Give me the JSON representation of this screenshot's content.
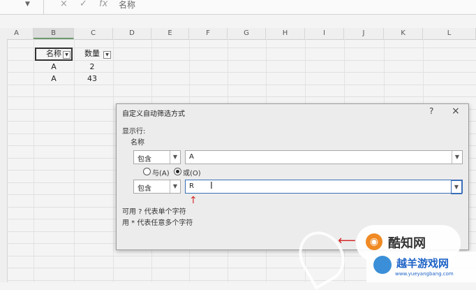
{
  "formula_bar": {
    "cancel_glyph": "×",
    "enter_glyph": "✓",
    "fx_glyph": "fx",
    "content": "名称"
  },
  "columns": [
    "A",
    "B",
    "C",
    "D",
    "E",
    "F",
    "G",
    "H",
    "I",
    "J",
    "K",
    "L"
  ],
  "selected_column": "B",
  "table": {
    "headers": [
      "名称",
      "数量"
    ],
    "rows": [
      [
        "A",
        "2"
      ],
      [
        "A",
        "43"
      ]
    ]
  },
  "dialog": {
    "title": "自定义自动筛选方式",
    "help": "?",
    "close": "×",
    "show_rows_label": "显示行:",
    "field_label": "名称",
    "condition1": {
      "operator": "包含",
      "value": "A"
    },
    "radio_and": "与(A)",
    "radio_or": "或(O)",
    "selected_radio": "or",
    "condition2": {
      "operator": "包含",
      "value": "R"
    },
    "hint1": "可用 ? 代表单个字符",
    "hint2": "用 * 代表任意多个字符"
  },
  "watermarks": {
    "top": "酷知网",
    "bottom": "越羊游戏网",
    "bottom_url": "www.yueyangbang.com"
  },
  "colors": {
    "accent_red": "#d42a2a",
    "header_bg": "#efefef",
    "watermark_orange": "#f08a24",
    "watermark_blue": "#1e63c7"
  }
}
